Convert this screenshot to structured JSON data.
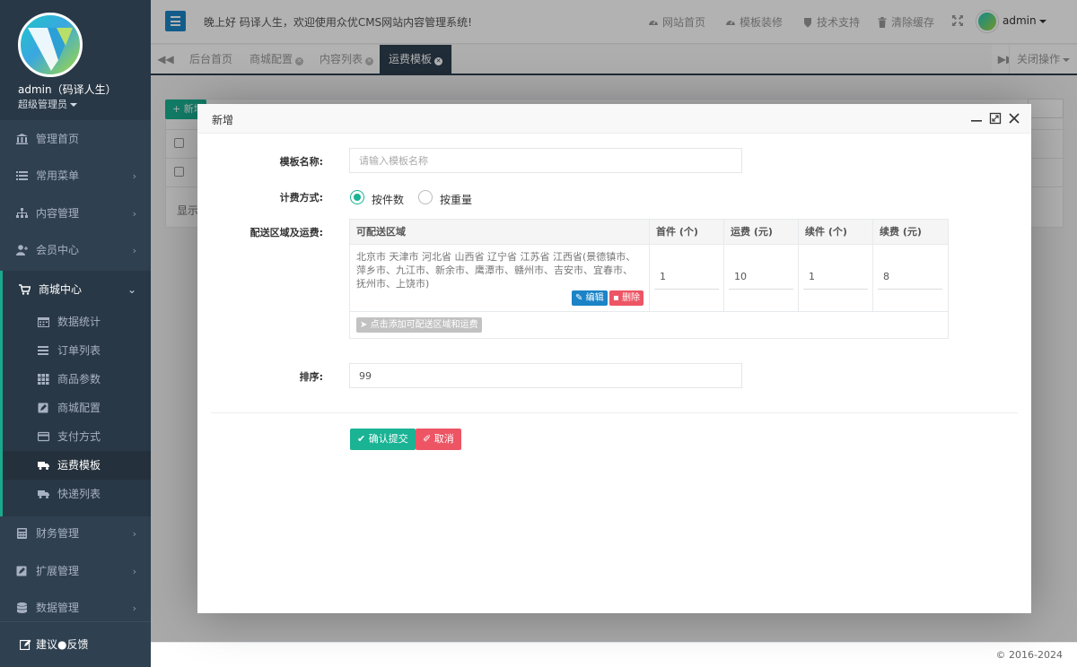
{
  "sidebar": {
    "user_name": "admin（码译人生）",
    "user_role": "超级管理员",
    "items": [
      {
        "label": "管理首页"
      },
      {
        "label": "常用菜单"
      },
      {
        "label": "内容管理"
      },
      {
        "label": "会员中心"
      }
    ],
    "group": {
      "label": "商城中心",
      "subitems": [
        {
          "label": "数据统计"
        },
        {
          "label": "订单列表"
        },
        {
          "label": "商品参数"
        },
        {
          "label": "商城配置"
        },
        {
          "label": "支付方式"
        },
        {
          "label": "运费模板"
        },
        {
          "label": "快递列表"
        }
      ]
    },
    "items_after": [
      {
        "label": "财务管理"
      },
      {
        "label": "扩展管理"
      },
      {
        "label": "数据管理"
      }
    ],
    "footer": "建议●反馈"
  },
  "topbar": {
    "welcome": "晚上好 码译人生，欢迎使用众优CMS网站内容管理系统!",
    "links": [
      "网站首页",
      "模板装修",
      "技术支持",
      "清除缓存"
    ],
    "user": "admin"
  },
  "tabs": {
    "items": [
      "后台首页",
      "商城配置",
      "内容列表",
      "运费模板"
    ],
    "close_ops": "关闭操作"
  },
  "background": {
    "add_button": "新增",
    "info_text": "显示"
  },
  "footer": "© 2016-2024",
  "modal": {
    "title": "新增",
    "name_label": "模板名称:",
    "name_placeholder": "请输入模板名称",
    "billing_label": "计费方式:",
    "billing_options": [
      "按件数",
      "按重量"
    ],
    "billing_selected": "按件数",
    "area_label": "配送区域及运费:",
    "table": {
      "headers": [
        "可配送区域",
        "首件 (个)",
        "运费 (元)",
        "续件 (个)",
        "续费 (元)"
      ],
      "rows": [
        {
          "regions": "北京市   天津市   河北省   山西省   辽宁省   江苏省   江西省(景德镇市、萍乡市、九江市、新余市、鹰潭市、赣州市、吉安市、宜春市、抚州市、上饶市)",
          "first": "1",
          "fee": "10",
          "extra": "1",
          "extra_fee": "8",
          "edit_label": "编辑",
          "delete_label": "删除"
        }
      ],
      "add_area_label": "点击添加可配送区域和运费"
    },
    "sort_label": "排序:",
    "sort_value": "99",
    "submit_label": "确认提交",
    "cancel_label": "取消"
  },
  "colors": {
    "sidebar": "#2f4050",
    "accent_green": "#1ab394",
    "primary_blue": "#1c84c6",
    "danger": "#ed5565"
  }
}
